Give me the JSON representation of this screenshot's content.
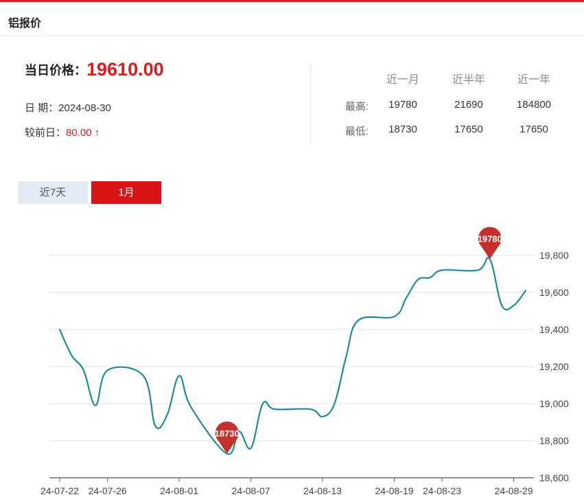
{
  "header": {
    "title": "铝报价"
  },
  "summary": {
    "price_label": "当日价格：",
    "price_value": "19610.00",
    "date_label": "日 期：",
    "date_value": "2024-08-30",
    "change_label": "较前日：",
    "change_value": "80.00 ↑"
  },
  "stats": {
    "columns": [
      "近一月",
      "近半年",
      "近一年"
    ],
    "rows": [
      {
        "label": "最高:",
        "values": [
          "19780",
          "21690",
          "184800"
        ]
      },
      {
        "label": "最低:",
        "values": [
          "18730",
          "17650",
          "17650"
        ]
      }
    ]
  },
  "tabs": [
    {
      "label": "近7天",
      "active": false
    },
    {
      "label": "1月",
      "active": true
    }
  ],
  "colors": {
    "accent": "#d91414",
    "line": "#1d8a96",
    "pin": "#c4302b",
    "grid": "#e0e0e0"
  },
  "chart_data": {
    "type": "line",
    "x_ticks": [
      "24-07-22",
      "24-07-26",
      "24-08-01",
      "24-08-07",
      "24-08-13",
      "24-08-19",
      "24-08-23",
      "24-08-29"
    ],
    "ylim": [
      18600,
      19800
    ],
    "y_ticks": [
      18600,
      18800,
      19000,
      19200,
      19400,
      19600,
      19800
    ],
    "y_tick_labels": [
      "18,600",
      "18,800",
      "19,000",
      "19,200",
      "19,400",
      "19,600",
      "19,800"
    ],
    "grid": true,
    "series": [
      {
        "x": [
          "24-07-22",
          "24-07-23",
          "24-07-24",
          "24-07-25",
          "24-07-26",
          "24-07-29",
          "24-07-30",
          "24-07-31",
          "24-08-01",
          "24-08-02",
          "24-08-05",
          "24-08-06",
          "24-08-07",
          "24-08-08",
          "24-08-09",
          "24-08-12",
          "24-08-13",
          "24-08-14",
          "24-08-15",
          "24-08-16",
          "24-08-19",
          "24-08-20",
          "24-08-21",
          "24-08-22",
          "24-08-23",
          "24-08-26",
          "24-08-27",
          "24-08-28",
          "24-08-29",
          "24-08-30"
        ],
        "values": [
          19400,
          19260,
          19180,
          18990,
          19180,
          19150,
          18880,
          18940,
          19150,
          18980,
          18730,
          18850,
          18760,
          19000,
          18970,
          18970,
          18930,
          19000,
          19260,
          19450,
          19470,
          19570,
          19670,
          19680,
          19720,
          19720,
          19780,
          19530,
          19530,
          19610
        ]
      }
    ],
    "markers": [
      {
        "label": "18730",
        "x": "24-08-05",
        "value": 18730
      },
      {
        "label": "19780",
        "x": "24-08-27",
        "value": 19780
      }
    ]
  }
}
